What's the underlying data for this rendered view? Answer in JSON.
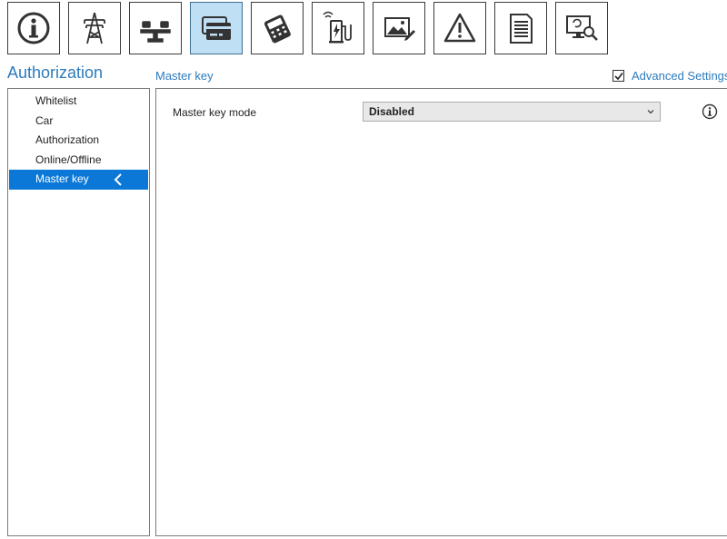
{
  "toolbar": {
    "buttons": [
      {
        "icon": "info-icon",
        "active": false
      },
      {
        "icon": "power-pylon-icon",
        "active": false
      },
      {
        "icon": "balance-icon",
        "active": false
      },
      {
        "icon": "cards-icon",
        "active": true
      },
      {
        "icon": "payment-terminal-icon",
        "active": false
      },
      {
        "icon": "charging-station-icon",
        "active": false
      },
      {
        "icon": "image-edit-icon",
        "active": false
      },
      {
        "icon": "warning-icon",
        "active": false
      },
      {
        "icon": "document-icon",
        "active": false
      },
      {
        "icon": "monitor-search-icon",
        "active": false
      }
    ]
  },
  "section": {
    "title": "Authorization"
  },
  "panel": {
    "title": "Master key"
  },
  "advanced": {
    "label": "Advanced Settings",
    "checked": true
  },
  "sidebar": {
    "items": [
      {
        "label": "Whitelist"
      },
      {
        "label": "Car"
      },
      {
        "label": "Authorization"
      },
      {
        "label": "Online/Offline"
      },
      {
        "label": "Master key"
      }
    ],
    "selected_index": 4
  },
  "form": {
    "master_key_mode_label": "Master key mode",
    "master_key_mode_value": "Disabled"
  },
  "colors": {
    "accent": "#2d7bbd",
    "selection": "#0b78d7",
    "active_tab": "#bfe0f4"
  }
}
